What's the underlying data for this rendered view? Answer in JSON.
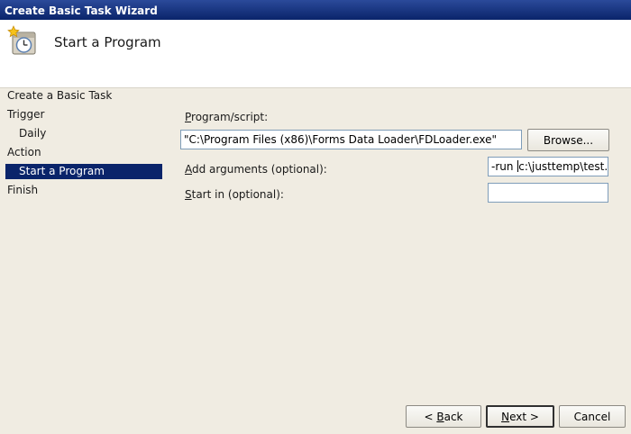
{
  "window": {
    "title": "Create Basic Task Wizard"
  },
  "header": {
    "title": "Start a Program",
    "icon": "task-clock-icon"
  },
  "nav": {
    "items": [
      {
        "label": "Create a Basic Task"
      },
      {
        "label": "Trigger"
      },
      {
        "label": "Daily"
      },
      {
        "label": "Action"
      },
      {
        "label": "Start a Program",
        "selected": true
      },
      {
        "label": "Finish"
      }
    ]
  },
  "form": {
    "program_label_mnemonic": "P",
    "program_label_rest": "rogram/script:",
    "program_value": "\"C:\\Program Files (x86)\\Forms Data Loader\\FDLoader.exe\"",
    "browse_label": "Browse...",
    "args_label_mnemonic": "A",
    "args_label_rest": "dd arguments (optional):",
    "args_value_before_caret": "-run ",
    "args_value_after_caret": "c:\\justtemp\\test.dlf",
    "startin_label_mnemonic": "S",
    "startin_label_rest": "tart in (optional):",
    "startin_value": ""
  },
  "footer": {
    "back_prefix": "< ",
    "back_mnemonic": "B",
    "back_rest": "ack",
    "next_mnemonic": "N",
    "next_rest": "ext >",
    "cancel_label": "Cancel"
  }
}
